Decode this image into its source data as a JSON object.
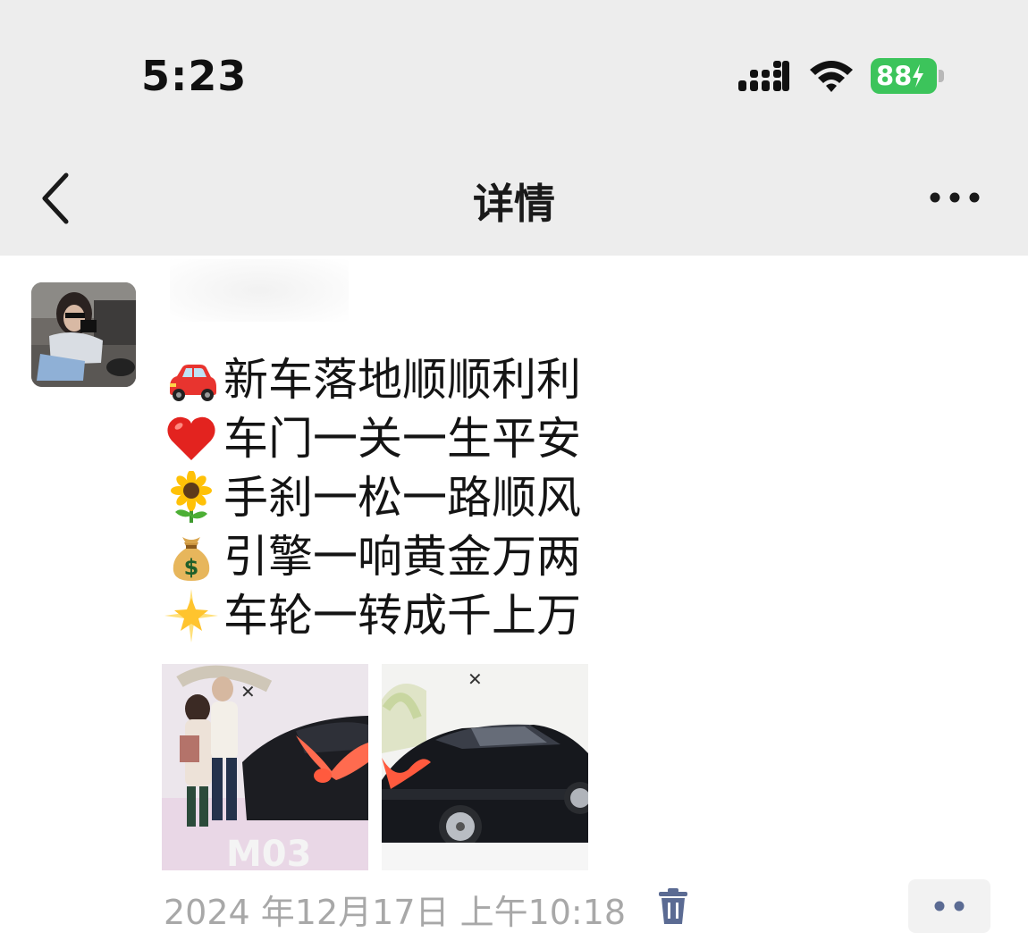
{
  "status_bar": {
    "time": "5:23",
    "battery": "88",
    "signal_icon": "signal-bars-icon",
    "wifi_icon": "wifi-icon"
  },
  "nav": {
    "title": "详情",
    "back_icon": "back-chevron-icon",
    "more_icon": "more-dots-icon"
  },
  "post": {
    "lines": [
      {
        "icon": "car-emoji-icon",
        "text": "新车落地顺顺利利"
      },
      {
        "icon": "heart-emoji-icon",
        "text": "车门一关一生平安"
      },
      {
        "icon": "sunflower-emoji-icon",
        "text": "手刹一松一路顺风"
      },
      {
        "icon": "money-bag-emoji-icon",
        "text": "引擎一响黄金万两"
      },
      {
        "icon": "star-emoji-icon",
        "text": "车轮一转成千上万"
      }
    ],
    "photo_label_1": "M03",
    "timestamp": "2024 年12月17日 上午10:18"
  },
  "colors": {
    "header_bg": "#ededed",
    "battery_green": "#3cc45b",
    "timestamp_gray": "#a8a8a8",
    "icon_blue": "#5b6b93"
  }
}
